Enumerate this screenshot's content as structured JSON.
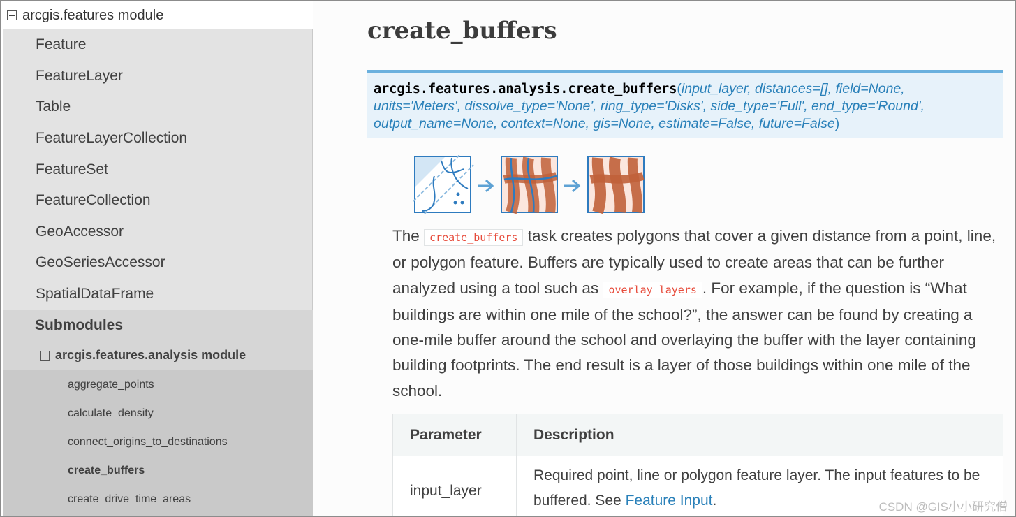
{
  "sidebar": {
    "module_title": "arcgis.features module",
    "classes": [
      "Feature",
      "FeatureLayer",
      "Table",
      "FeatureLayerCollection",
      "FeatureSet",
      "FeatureCollection",
      "GeoAccessor",
      "GeoSeriesAccessor",
      "SpatialDataFrame"
    ],
    "submodules_label": "Submodules",
    "analysis_module_label": "arcgis.features.analysis module",
    "functions": [
      "aggregate_points",
      "calculate_density",
      "connect_origins_to_destinations",
      "create_buffers",
      "create_drive_time_areas"
    ],
    "active_function": "create_buffers"
  },
  "main": {
    "title": "create_buffers",
    "signature": {
      "name": "arcgis.features.analysis.create_buffers",
      "open_paren": "(",
      "line1": "input_layer, distances=[], field=None,",
      "line2": "units='Meters', dissolve_type='None', ring_type='Disks', side_type='Full', end_type='Round',",
      "line3": "output_name=None, context=None, gis=None, estimate=False, future=False",
      "close_paren": ")"
    },
    "description": {
      "p1": "The ",
      "code1": "create_buffers",
      "p2": " task creates polygons that cover a given distance from a point, line, or polygon feature. Buffers are typically used to create areas that can be further analyzed using a tool such as ",
      "code2": "overlay_layers",
      "p3": ". For example, if the question is “What buildings are within one mile of the school?”, the answer can be found by creating a one-mile buffer around the school and overlaying the buffer with the layer containing building footprints. The end result is a layer of those buildings within one mile of the school."
    },
    "param_table": {
      "headers": [
        "Parameter",
        "Description"
      ],
      "rows": [
        {
          "param": "input_layer",
          "desc": "Required point, line or polygon feature layer. The input features to be buffered. See ",
          "link": "Feature Input",
          "desc_end": "."
        }
      ]
    }
  },
  "watermark": "CSDN @GIS小小研究僧",
  "colors": {
    "accent": "#2980b9",
    "signature_bg": "#e7f2fa",
    "signature_border": "#6ab0de",
    "code_red": "#e74c3c",
    "buffer_orange": "#c0603a"
  }
}
